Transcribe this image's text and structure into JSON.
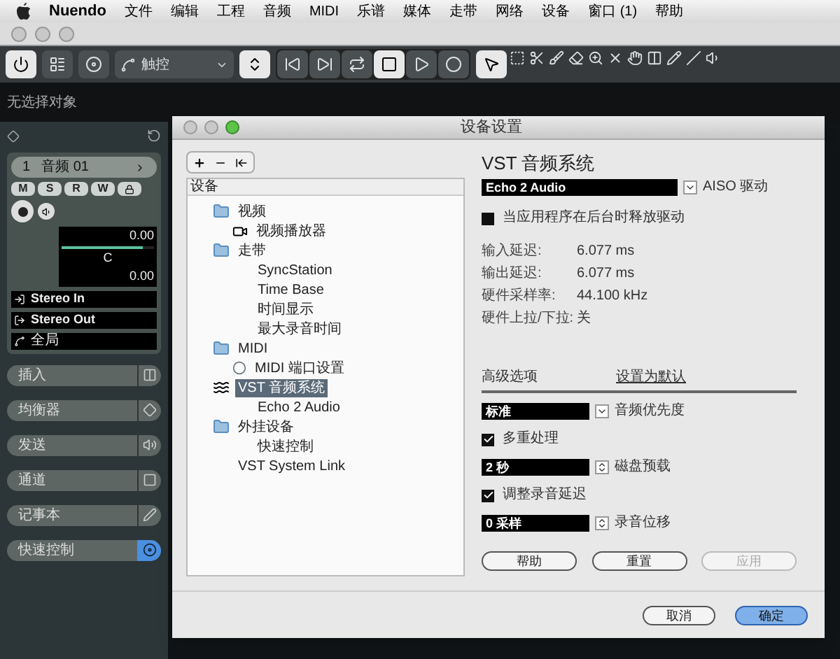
{
  "menu_bar": {
    "app": "Nuendo",
    "items": [
      "文件",
      "编辑",
      "工程",
      "音频",
      "MIDI",
      "乐谱",
      "媒体",
      "走带",
      "网络",
      "设备",
      "窗口 (1)",
      "帮助"
    ]
  },
  "toolbar": {
    "automation_mode": "触控"
  },
  "info_line": "无选择对象",
  "inspector": {
    "track_number": "1",
    "track_name": "音频 01",
    "buttons": [
      "M",
      "S",
      "R",
      "W"
    ],
    "volume": {
      "reading": "0.00",
      "level": 0.88
    },
    "pan": {
      "reading": "C"
    },
    "delay": {
      "reading": "0.00"
    },
    "routing": [
      {
        "kind": "input",
        "label": "Stereo In"
      },
      {
        "kind": "output",
        "label": "Stereo Out"
      }
    ],
    "automation": "全局",
    "sections": [
      {
        "label": "插入",
        "active": false
      },
      {
        "label": "均衡器",
        "active": false
      },
      {
        "label": "发送",
        "active": false
      },
      {
        "label": "通道",
        "active": false
      },
      {
        "label": "记事本",
        "active": false
      },
      {
        "label": "快速控制",
        "active": true
      }
    ]
  },
  "dialog": {
    "title": "设备设置",
    "tree_header": "设备",
    "tree": [
      {
        "kind": "folder",
        "label": "视频",
        "selected": false,
        "children": [
          {
            "kind": "video",
            "label": "视频播放器",
            "selected": false
          }
        ]
      },
      {
        "kind": "folder",
        "label": "走带",
        "selected": false,
        "children": [
          {
            "kind": "plain",
            "label": "SyncStation",
            "selected": false
          },
          {
            "kind": "plain",
            "label": "Time Base",
            "selected": false
          },
          {
            "kind": "plain",
            "label": "时间显示",
            "selected": false
          },
          {
            "kind": "plain",
            "label": "最大录音时间",
            "selected": false
          }
        ]
      },
      {
        "kind": "folder",
        "label": "MIDI",
        "selected": false,
        "children": [
          {
            "kind": "midi",
            "label": "MIDI 端口设置",
            "selected": false
          }
        ]
      },
      {
        "kind": "audio",
        "label": "VST 音频系统",
        "selected": true,
        "children": [
          {
            "kind": "plain",
            "label": "Echo 2 Audio",
            "selected": false
          }
        ]
      },
      {
        "kind": "folder",
        "label": "外挂设备",
        "selected": false,
        "children": [
          {
            "kind": "plain",
            "label": "快速控制",
            "selected": false
          }
        ]
      },
      {
        "kind": "plain",
        "label": "VST System Link",
        "selected": false
      }
    ],
    "panel_title": "VST 音频系统",
    "driver": {
      "value": "Echo 2 Audio",
      "label": "AISO 驱动"
    },
    "release_driver": {
      "label": "当应用程序在后台时释放驱动",
      "checked": false
    },
    "info": [
      {
        "label": "输入延迟:",
        "value": "6.077 ms"
      },
      {
        "label": "输出延迟:",
        "value": "6.077 ms"
      },
      {
        "label": "硬件采样率:",
        "value": "44.100 kHz"
      },
      {
        "label": "硬件上拉/下拉:",
        "value": "关"
      }
    ],
    "advanced_label": "高级选项",
    "set_default": "设置为默认",
    "options": [
      {
        "kind": "select",
        "value": "标准",
        "suffix": "音频优先度"
      },
      {
        "kind": "checkbox",
        "label": "多重处理",
        "checked": true
      },
      {
        "kind": "spinner",
        "value": "2 秒",
        "suffix": "磁盘预载"
      },
      {
        "kind": "checkbox",
        "label": "调整录音延迟",
        "checked": true
      },
      {
        "kind": "spinner",
        "value": "0 采样",
        "suffix": "录音位移"
      }
    ],
    "panel_buttons": [
      {
        "label": "帮助",
        "disabled": false
      },
      {
        "label": "重置",
        "disabled": false
      },
      {
        "label": "应用",
        "disabled": true
      }
    ],
    "footer_buttons": [
      {
        "label": "取消",
        "primary": false
      },
      {
        "label": "确定",
        "primary": true
      }
    ]
  }
}
